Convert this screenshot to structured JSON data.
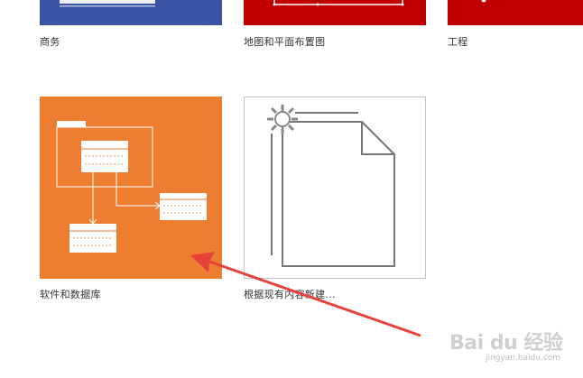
{
  "templates": [
    {
      "label": "商务",
      "color": "#3a55a5"
    },
    {
      "label": "地图和平面布置图",
      "color": "#c00000"
    },
    {
      "label": "工程",
      "color": "#c00000"
    },
    {
      "label": "软件和数据库",
      "color": "#ed7d31"
    },
    {
      "label": "根据现有内容新建..."
    }
  ],
  "watermark": {
    "main": "Bai du 经验",
    "sub": "jingyan.baidu.com"
  },
  "annotation": {
    "color": "#e8413c"
  }
}
